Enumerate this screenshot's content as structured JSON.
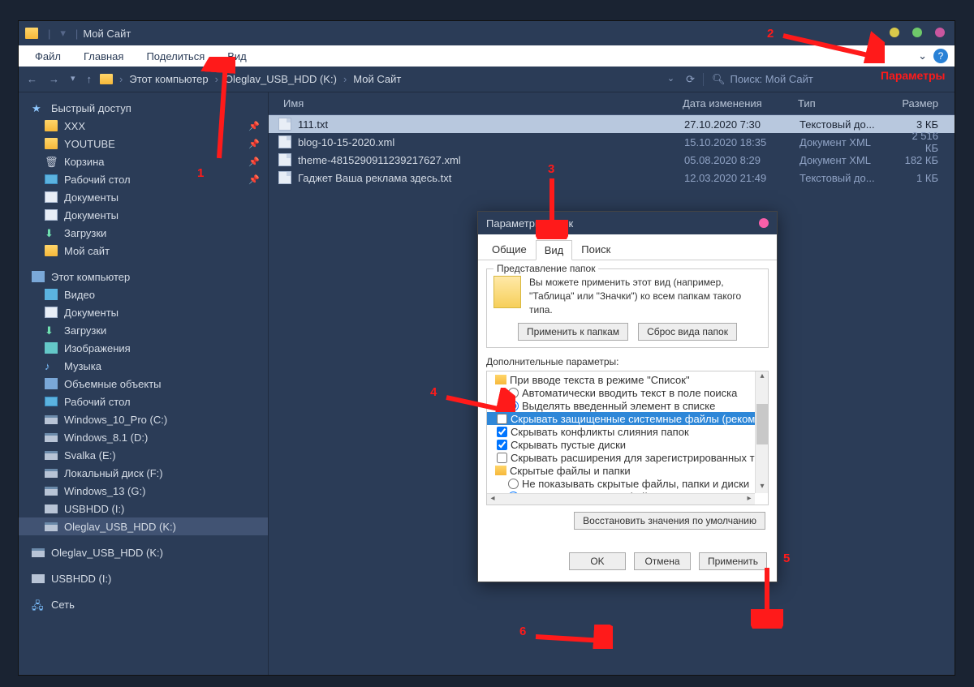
{
  "window": {
    "title": "Мой Сайт",
    "dots": [
      "#d9c94a",
      "#6fc96a",
      "#c9569e"
    ]
  },
  "menubar": {
    "items": [
      "Файл",
      "Главная",
      "Поделиться",
      "Вид"
    ],
    "chev": "⌄"
  },
  "addrbar": {
    "crumbs": [
      "Этот компьютер",
      "Oleglav_USB_HDD (K:)",
      "Мой Сайт"
    ],
    "search_label": "Поиск: Мой Сайт"
  },
  "sidebar": {
    "quick": "Быстрый доступ",
    "q_items": [
      {
        "label": "XXX",
        "ic": "folder",
        "pin": true
      },
      {
        "label": "YOUTUBE",
        "ic": "folder",
        "pin": true
      },
      {
        "label": "Корзина",
        "ic": "trash",
        "pin": true
      },
      {
        "label": "Рабочий стол",
        "ic": "desk",
        "pin": true
      },
      {
        "label": "Документы",
        "ic": "doc",
        "pin": false
      },
      {
        "label": "Документы",
        "ic": "doc",
        "pin": false
      },
      {
        "label": "Загрузки",
        "ic": "down",
        "pin": false
      },
      {
        "label": "Мой сайт",
        "ic": "folder",
        "pin": false
      }
    ],
    "pc": "Этот компьютер",
    "pc_items": [
      {
        "label": "Видео",
        "ic": "vid"
      },
      {
        "label": "Документы",
        "ic": "doc"
      },
      {
        "label": "Загрузки",
        "ic": "down"
      },
      {
        "label": "Изображения",
        "ic": "img"
      },
      {
        "label": "Музыка",
        "ic": "music"
      },
      {
        "label": "Объемные объекты",
        "ic": "obj"
      },
      {
        "label": "Рабочий стол",
        "ic": "desk"
      },
      {
        "label": "Windows_10_Pro (C:)",
        "ic": "drive"
      },
      {
        "label": "Windows_8.1 (D:)",
        "ic": "drive"
      },
      {
        "label": "Svalka (E:)",
        "ic": "drive"
      },
      {
        "label": "Локальный диск (F:)",
        "ic": "drive"
      },
      {
        "label": "Windows_13 (G:)",
        "ic": "drive"
      },
      {
        "label": "USBHDD (I:)",
        "ic": "usb"
      },
      {
        "label": "Oleglav_USB_HDD (K:)",
        "ic": "drive",
        "sel": true
      }
    ],
    "ext": [
      {
        "label": "Oleglav_USB_HDD (K:)",
        "ic": "drive"
      },
      {
        "label": "USBHDD (I:)",
        "ic": "usb"
      }
    ],
    "net": "Сеть"
  },
  "columns": {
    "name": "Имя",
    "date": "Дата изменения",
    "type": "Тип",
    "size": "Размер"
  },
  "files": [
    {
      "name": "111.txt",
      "date": "27.10.2020 7:30",
      "type": "Текстовый до...",
      "size": "3 КБ",
      "sel": true
    },
    {
      "name": "blog-10-15-2020.xml",
      "date": "15.10.2020 18:35",
      "type": "Документ XML",
      "size": "2 516 КБ"
    },
    {
      "name": "theme-4815290911239217627.xml",
      "date": "05.08.2020 8:29",
      "type": "Документ XML",
      "size": "182 КБ"
    },
    {
      "name": "Гаджет Ваша реклама здесь.txt",
      "date": "12.03.2020 21:49",
      "type": "Текстовый до...",
      "size": "1 КБ"
    }
  ],
  "dialog": {
    "title": "Параметры папок",
    "tabs": [
      "Общие",
      "Вид",
      "Поиск"
    ],
    "group_legend": "Представление папок",
    "group_text": "Вы можете применить этот вид (например, \"Таблица\" или \"Значки\") ко всем папкам такого типа.",
    "btn_apply_folders": "Применить к папкам",
    "btn_reset_folders": "Сброс вида папок",
    "adv_label": "Дополнительные параметры:",
    "adv": [
      {
        "t": "folder",
        "label": "При вводе текста в режиме \"Список\""
      },
      {
        "t": "radio",
        "checked": false,
        "label": "Автоматически вводить текст в поле поиска"
      },
      {
        "t": "radio",
        "checked": true,
        "label": "Выделять введенный элемент в списке"
      },
      {
        "t": "check",
        "checked": false,
        "hl": true,
        "label": "Скрывать защищенные системные файлы (рекомен..."
      },
      {
        "t": "check",
        "checked": true,
        "label": "Скрывать конфликты слияния папок"
      },
      {
        "t": "check",
        "checked": true,
        "label": "Скрывать пустые диски"
      },
      {
        "t": "check",
        "checked": false,
        "label": "Скрывать расширения для зарегистрированных тип..."
      },
      {
        "t": "folder",
        "label": "Скрытые файлы и папки"
      },
      {
        "t": "radio",
        "checked": false,
        "label": "Не показывать скрытые файлы, папки и диски"
      },
      {
        "t": "radio",
        "checked": true,
        "label": "Показывать скрытые файлы, папки и диски"
      }
    ],
    "restore": "Восстановить значения по умолчанию",
    "ok": "OK",
    "cancel": "Отмена",
    "apply": "Применить"
  },
  "annotations": {
    "n1": "1",
    "n2": "2",
    "n3": "3",
    "n4": "4",
    "n5": "5",
    "n6": "6",
    "param": "Параметры"
  }
}
